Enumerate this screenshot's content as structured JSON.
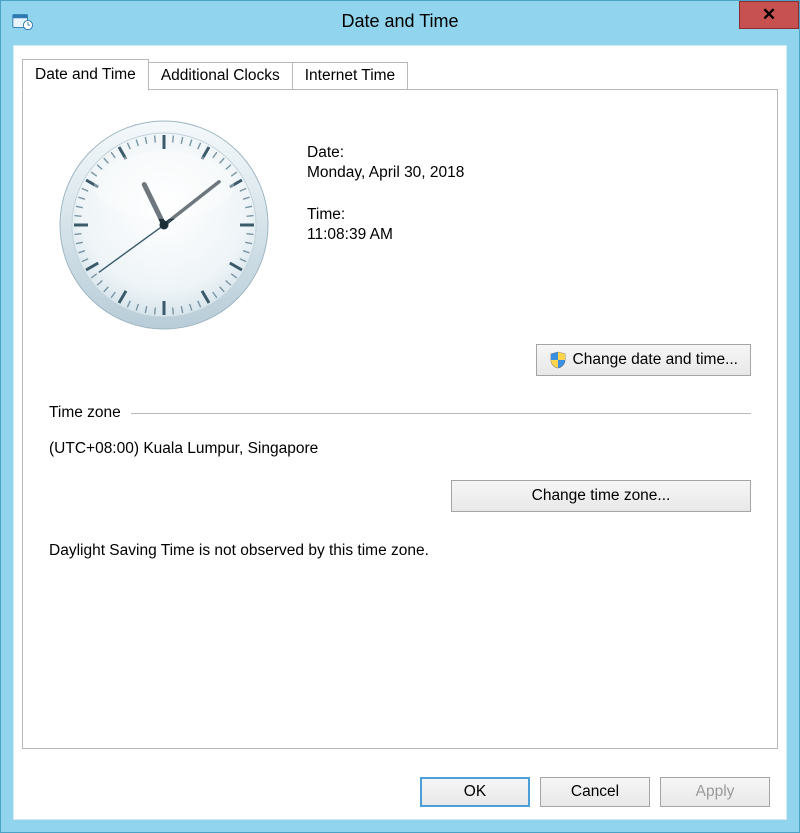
{
  "window": {
    "title": "Date and Time"
  },
  "tabs": [
    {
      "label": "Date and Time"
    },
    {
      "label": "Additional Clocks"
    },
    {
      "label": "Internet Time"
    }
  ],
  "date": {
    "label": "Date:",
    "value": "Monday, April 30, 2018"
  },
  "time": {
    "label": "Time:",
    "value": "11:08:39 AM"
  },
  "buttons": {
    "change_datetime": "Change date and time...",
    "change_timezone": "Change time zone...",
    "ok": "OK",
    "cancel": "Cancel",
    "apply": "Apply"
  },
  "timezone": {
    "section_label": "Time zone",
    "value": "(UTC+08:00) Kuala Lumpur, Singapore"
  },
  "dst_note": "Daylight Saving Time is not observed by this time zone.",
  "clock": {
    "hour": 11,
    "minute": 8,
    "second": 39
  }
}
